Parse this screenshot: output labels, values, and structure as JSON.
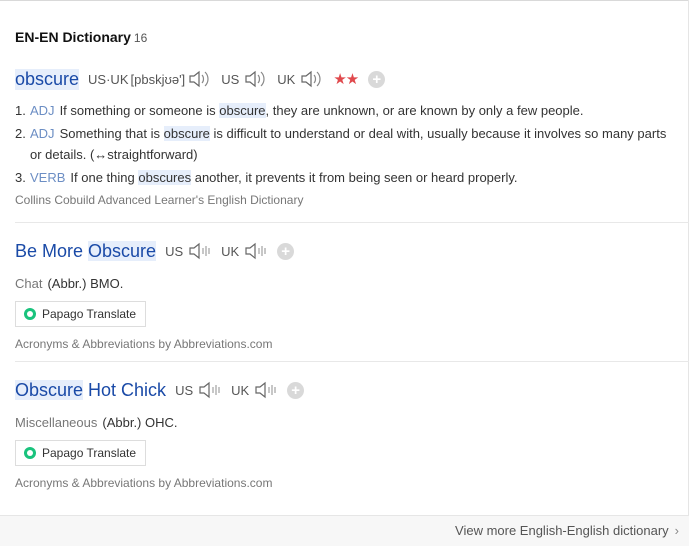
{
  "header": {
    "title": "EN-EN Dictionary",
    "count": "16"
  },
  "entry1": {
    "word": "obscure",
    "pron_label": "US·UK",
    "phonetic": "[pbskjʊə']",
    "us_label": "US",
    "uk_label": "UK",
    "stars": "★★",
    "add": "+",
    "senses": [
      {
        "num": "1.",
        "pos": "ADJ",
        "pre": "If something or someone is ",
        "hl": "obscure",
        "post": ", they are unknown, or are known by only a few people."
      },
      {
        "num": "2.",
        "pos": "ADJ",
        "pre": "Something that is ",
        "hl": "obscure",
        "post": " is difficult to understand or deal with, usually because it involves so many parts or details. (↔straightforward)"
      },
      {
        "num": "3.",
        "pos": "VERB",
        "pre": "If one thing ",
        "hl": "obscures",
        "post": " another, it prevents it from being seen or heard properly."
      }
    ],
    "source": "Collins Cobuild Advanced Learner's English Dictionary"
  },
  "entry2": {
    "word_pre": "Be More ",
    "word_hl": "Obscure",
    "word_post": "",
    "us_label": "US",
    "uk_label": "UK",
    "add": "+",
    "category": "Chat",
    "abbr": "(Abbr.) BMO.",
    "papago": "Papago Translate",
    "source": "Acronyms & Abbreviations by Abbreviations.com"
  },
  "entry3": {
    "word_pre": "",
    "word_hl": "Obscure",
    "word_post": " Hot Chick",
    "us_label": "US",
    "uk_label": "UK",
    "add": "+",
    "category": "Miscellaneous",
    "abbr": "(Abbr.) OHC.",
    "papago": "Papago Translate",
    "source": "Acronyms & Abbreviations by Abbreviations.com"
  },
  "footer": {
    "more": "View more English-English dictionary",
    "chevron": "›"
  },
  "colors": {
    "link": "#1a4aa7",
    "pos": "#6c8ec4",
    "star": "#e0494d",
    "highlight": "#e6eefb"
  }
}
